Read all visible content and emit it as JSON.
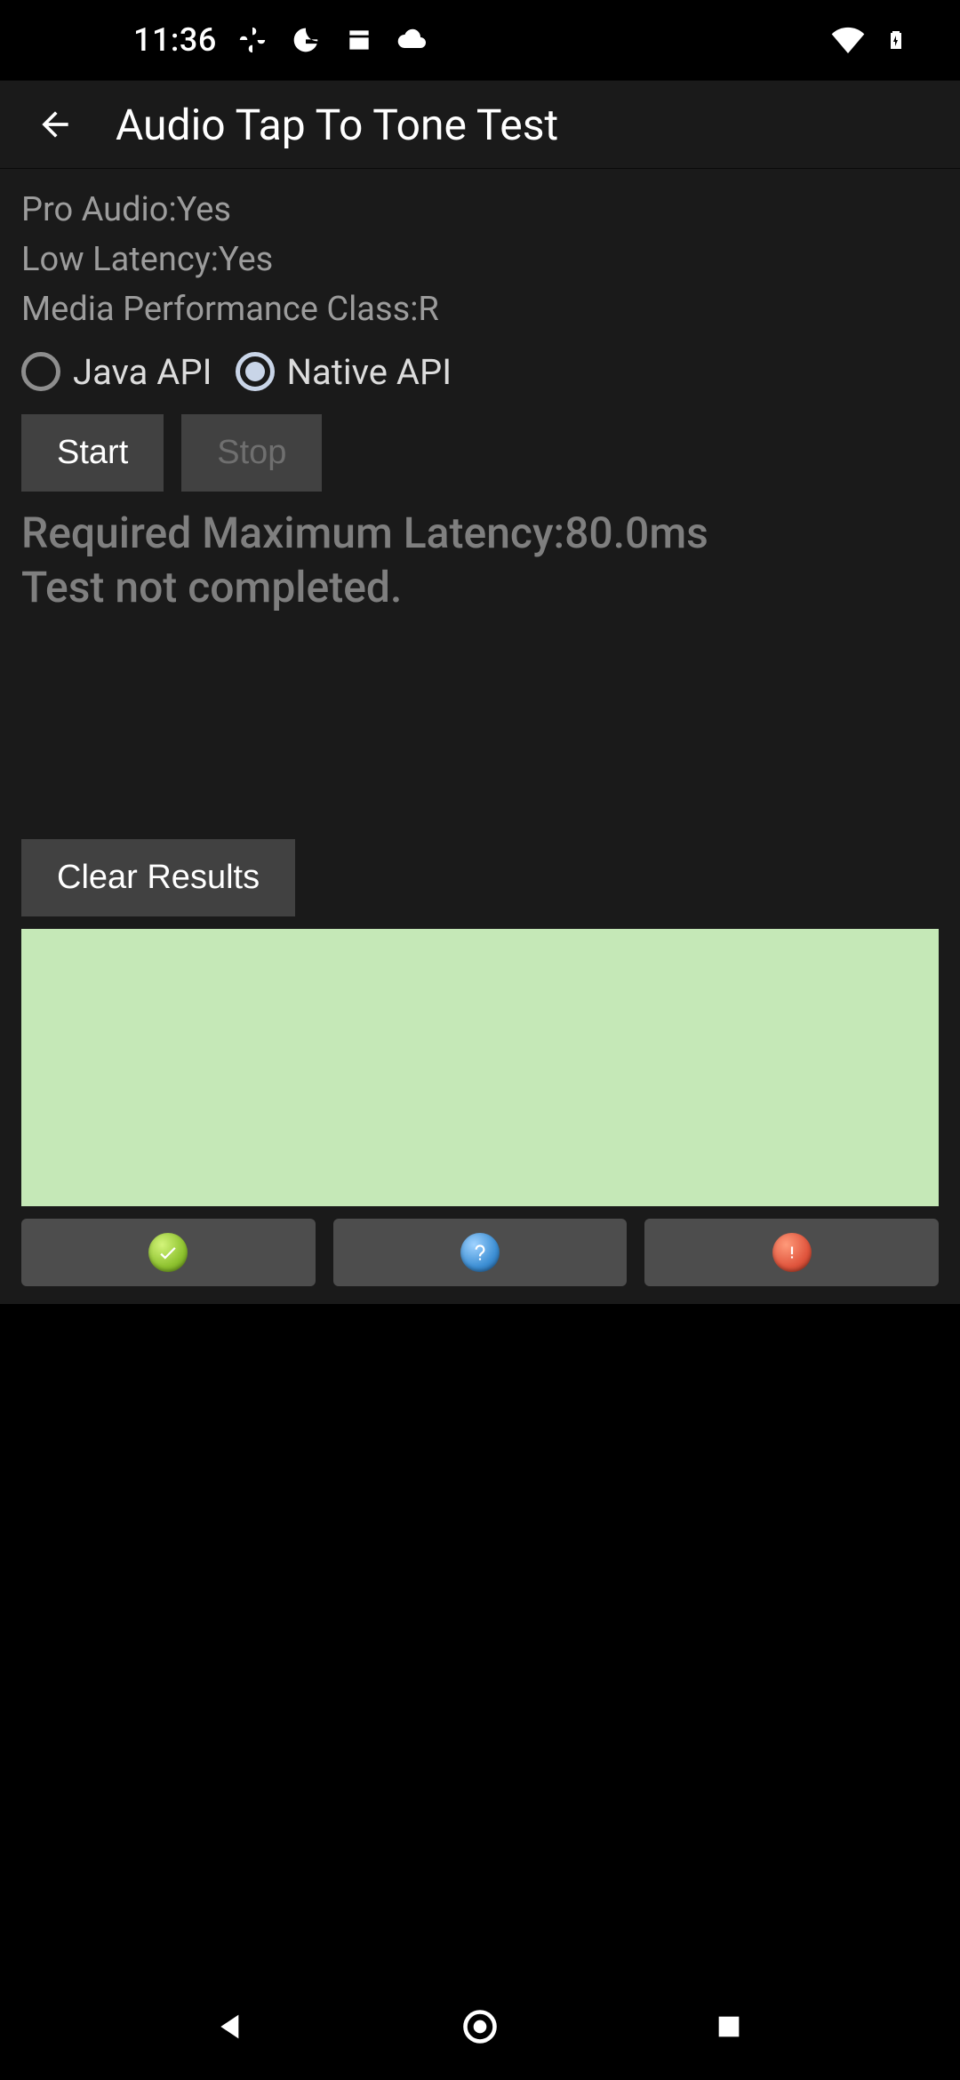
{
  "status_bar": {
    "time": "11:36",
    "icons": {
      "pinwheel": "pinwheel-icon",
      "g": "g-icon",
      "calendar": "calendar-icon",
      "cloud": "cloud-icon",
      "wifi": "wifi-icon",
      "battery": "battery-charging-icon"
    }
  },
  "app_bar": {
    "title": "Audio Tap To Tone Test"
  },
  "info": {
    "pro_audio_line": "Pro Audio:Yes",
    "low_latency_line": "Low Latency:Yes",
    "media_perf_line": "Media Performance Class:R"
  },
  "radios": {
    "java": {
      "label": "Java API",
      "selected": false
    },
    "native": {
      "label": "Native API",
      "selected": true
    }
  },
  "buttons": {
    "start": "Start",
    "stop": "Stop",
    "stop_enabled": false,
    "clear": "Clear Results"
  },
  "status": {
    "line1": "Required Maximum Latency:80.0ms",
    "line2": "Test not completed."
  },
  "panel": {
    "color": "#c5e8b7"
  },
  "result_buttons": {
    "pass": "pass",
    "info": "info",
    "fail": "fail"
  },
  "chart_data": null
}
